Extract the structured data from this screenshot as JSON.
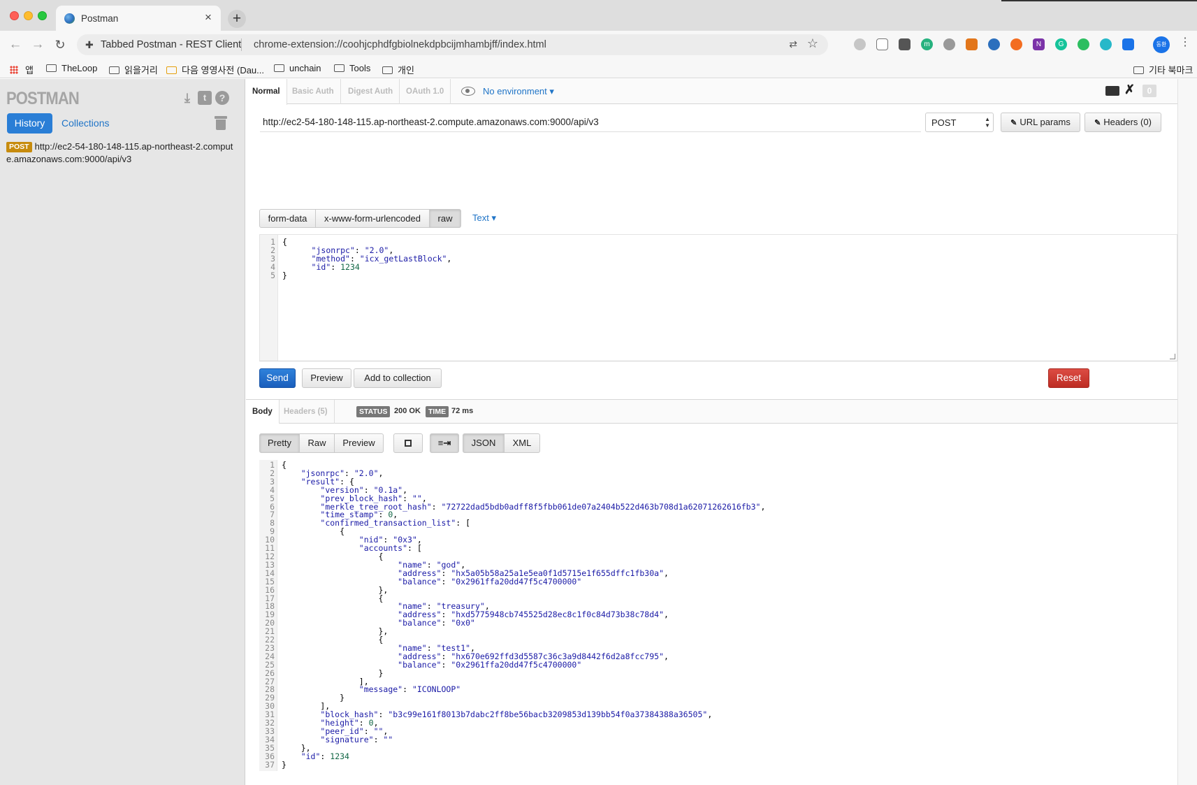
{
  "browser": {
    "tab_title": "Postman",
    "site_label": "Tabbed Postman - REST Client",
    "url": "chrome-extension://coohjcphdfgbiolnekdpbcijmhambjff/index.html",
    "profile_initials": "동환",
    "bookmarks": {
      "apps": "앱",
      "items": [
        "TheLoop",
        "읽을거리",
        "다음 영영사전 (Dau...",
        "unchain",
        "Tools",
        "개인"
      ],
      "other": "기타 북마크"
    }
  },
  "sidebar": {
    "logo": "POSTMAN",
    "tabs": {
      "history": "History",
      "collections": "Collections"
    },
    "history": [
      {
        "method": "POST",
        "url": "http://ec2-54-180-148-115.ap-northeast-2.compute.amazonaws.com:9000/api/v3"
      }
    ]
  },
  "auth_tabs": [
    "Normal",
    "Basic Auth",
    "Digest Auth",
    "OAuth 1.0"
  ],
  "environment": "No environment",
  "header_count": "0",
  "request": {
    "url": "http://ec2-54-180-148-115.ap-northeast-2.compute.amazonaws.com:9000/api/v3",
    "method": "POST",
    "url_params_label": "URL params",
    "headers_label": "Headers (0)",
    "body_modes": [
      "form-data",
      "x-www-form-urlencoded",
      "raw"
    ],
    "content_type": "Text",
    "body_lines": [
      "{",
      "      \"jsonrpc\": \"2.0\",",
      "      \"method\": \"icx_getLastBlock\",",
      "      \"id\": 1234",
      "}"
    ]
  },
  "actions": {
    "send": "Send",
    "preview": "Preview",
    "add_to_collection": "Add to collection",
    "reset": "Reset"
  },
  "response": {
    "tabs": [
      "Body",
      "Headers (5)"
    ],
    "status_label": "STATUS",
    "status_value": "200 OK",
    "time_label": "TIME",
    "time_value": "72 ms",
    "views": [
      "Pretty",
      "Raw",
      "Preview"
    ],
    "formats": [
      "JSON",
      "XML"
    ],
    "body_lines": [
      "{",
      "    \"jsonrpc\": \"2.0\",",
      "    \"result\": {",
      "        \"version\": \"0.1a\",",
      "        \"prev_block_hash\": \"\",",
      "        \"merkle_tree_root_hash\": \"72722dad5bdb0adff8f5fbb061de07a2404b522d463b708d1a62071262616fb3\",",
      "        \"time_stamp\": 0,",
      "        \"confirmed_transaction_list\": [",
      "            {",
      "                \"nid\": \"0x3\",",
      "                \"accounts\": [",
      "                    {",
      "                        \"name\": \"god\",",
      "                        \"address\": \"hx5a05b58a25a1e5ea0f1d5715e1f655dffc1fb30a\",",
      "                        \"balance\": \"0x2961ffa20dd47f5c4700000\"",
      "                    },",
      "                    {",
      "                        \"name\": \"treasury\",",
      "                        \"address\": \"hxd5775948cb745525d28ec8c1f0c84d73b38c78d4\",",
      "                        \"balance\": \"0x0\"",
      "                    },",
      "                    {",
      "                        \"name\": \"test1\",",
      "                        \"address\": \"hx670e692ffd3d5587c36c3a9d8442f6d2a8fcc795\",",
      "                        \"balance\": \"0x2961ffa20dd47f5c4700000\"",
      "                    }",
      "                ],",
      "                \"message\": \"ICONLOOP\"",
      "            }",
      "        ],",
      "        \"block_hash\": \"b3c99e161f8013b7dabc2ff8be56bacb3209853d139bb54f0a37384388a36505\",",
      "        \"height\": 0,",
      "        \"peer_id\": \"\",",
      "        \"signature\": \"\"",
      "    },",
      "    \"id\": 1234",
      "}"
    ]
  }
}
